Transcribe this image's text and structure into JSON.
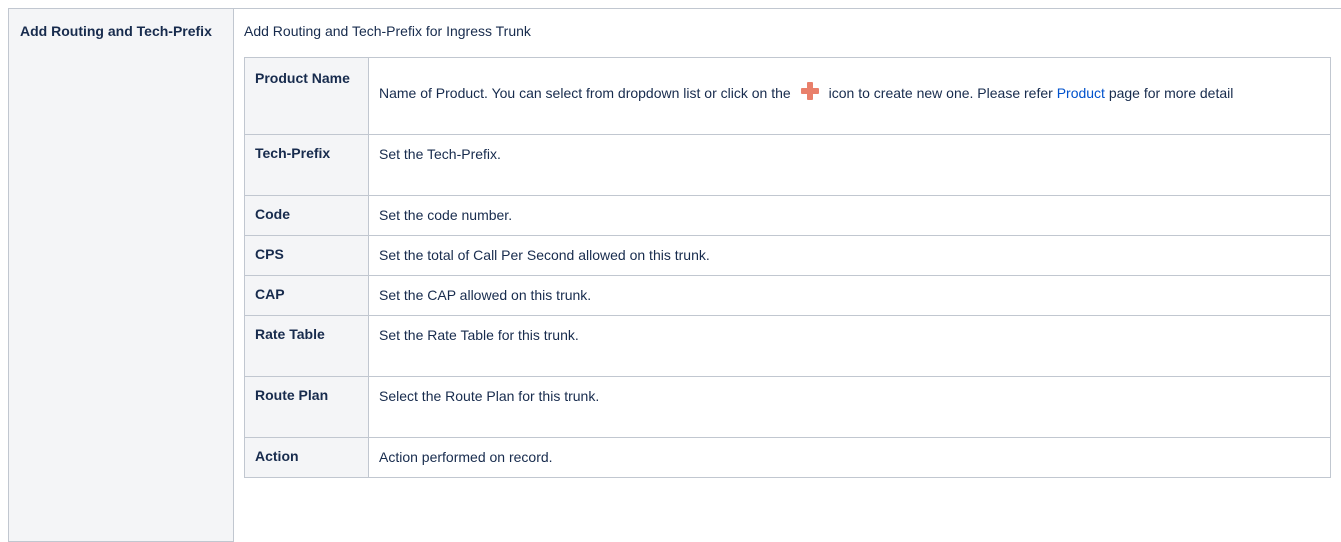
{
  "left": {
    "title": "Add Routing and Tech-Prefix"
  },
  "right": {
    "heading": "Add Routing and Tech-Prefix for Ingress Trunk",
    "rows": [
      {
        "key": "Product Name",
        "desc_part1": "Name of Product. You can select from dropdown list or click on the",
        "icon": "plus-icon",
        "desc_part2": "icon to create new one. Please refer",
        "link_text": "Product",
        "desc_part3": "page for more detail"
      },
      {
        "key": "Tech-Prefix",
        "desc": "Set the Tech-Prefix."
      },
      {
        "key": "Code",
        "desc": "Set the code number."
      },
      {
        "key": "CPS",
        "desc": "Set the total of Call Per Second allowed on this trunk."
      },
      {
        "key": "CAP",
        "desc": "Set the CAP allowed on this trunk."
      },
      {
        "key": "Rate Table",
        "desc": "Set the Rate Table for this trunk."
      },
      {
        "key": "Route Plan",
        "desc": "Select the Route Plan for this trunk."
      },
      {
        "key": "Action",
        "desc": "Action performed on record."
      }
    ]
  },
  "colors": {
    "border": "#c1c7d0",
    "header_bg": "#f4f5f7",
    "link": "#0052cc",
    "icon": "#e9806b"
  }
}
